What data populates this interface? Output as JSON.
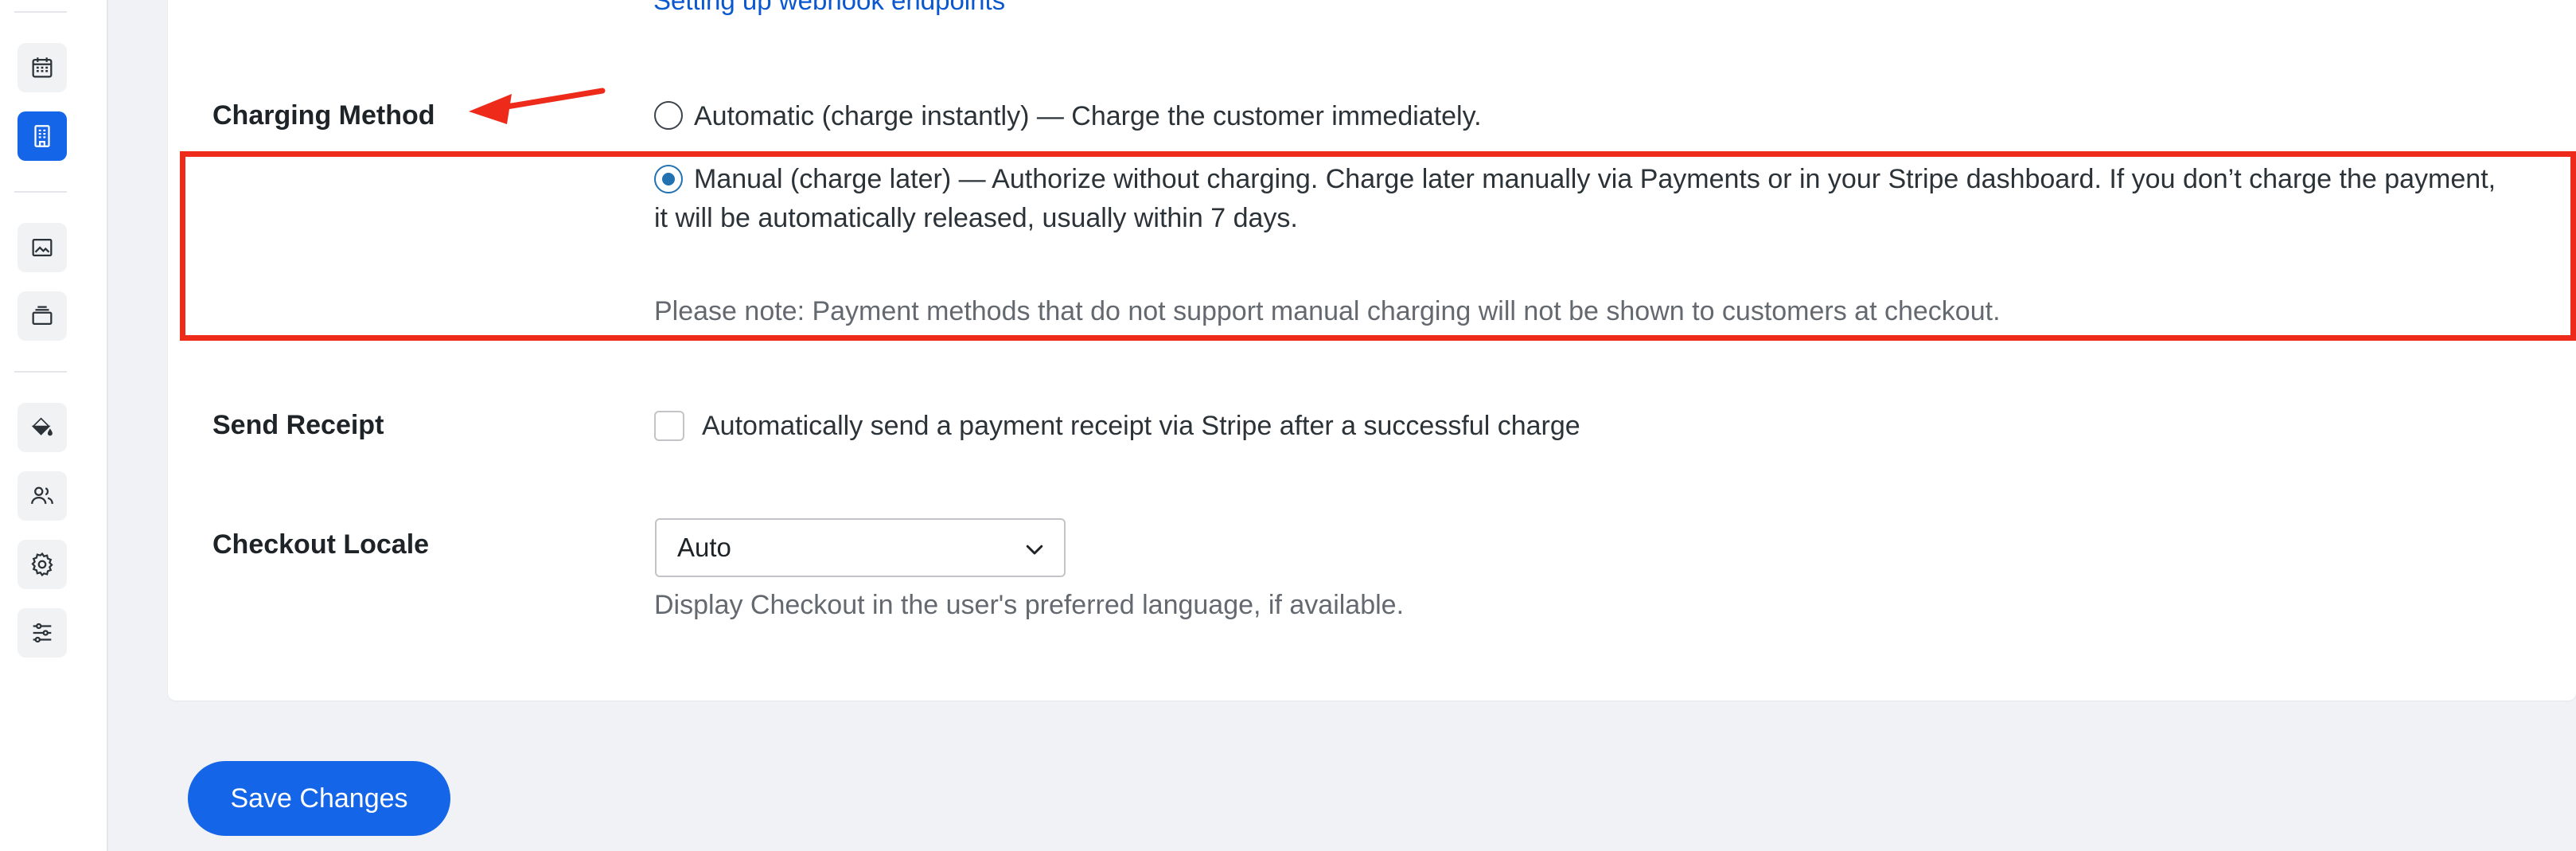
{
  "links": {
    "webhook": "Setting up webhook endpoints"
  },
  "charging_method": {
    "label": "Charging Method",
    "options": [
      {
        "text": "Automatic (charge instantly) — Charge the customer immediately.",
        "checked": false
      },
      {
        "text": "Manual (charge later) — Authorize without charging. Charge later manually via Payments or in your Stripe dashboard. If you don’t charge the payment, it will be automatically released, usually within 7 days.",
        "checked": true
      }
    ],
    "note": "Please note: Payment methods that do not support manual charging will not be shown to customers at checkout."
  },
  "send_receipt": {
    "label": "Send Receipt",
    "checkbox_label": "Automatically send a payment receipt via Stripe after a successful charge",
    "checked": false
  },
  "checkout_locale": {
    "label": "Checkout Locale",
    "selected": "Auto",
    "help": "Display Checkout in the user's preferred language, if available."
  },
  "actions": {
    "save_label": "Save Changes"
  },
  "sidebar": {
    "icons": [
      "calendar-icon",
      "building-icon",
      "image-icon",
      "layers-icon",
      "paint-bucket-icon",
      "users-icon",
      "gear-icon",
      "sliders-icon"
    ],
    "active": "building-icon"
  },
  "colors": {
    "accent": "#1565e8",
    "annotation": "#ee2a1a",
    "link": "#0b57d0"
  }
}
